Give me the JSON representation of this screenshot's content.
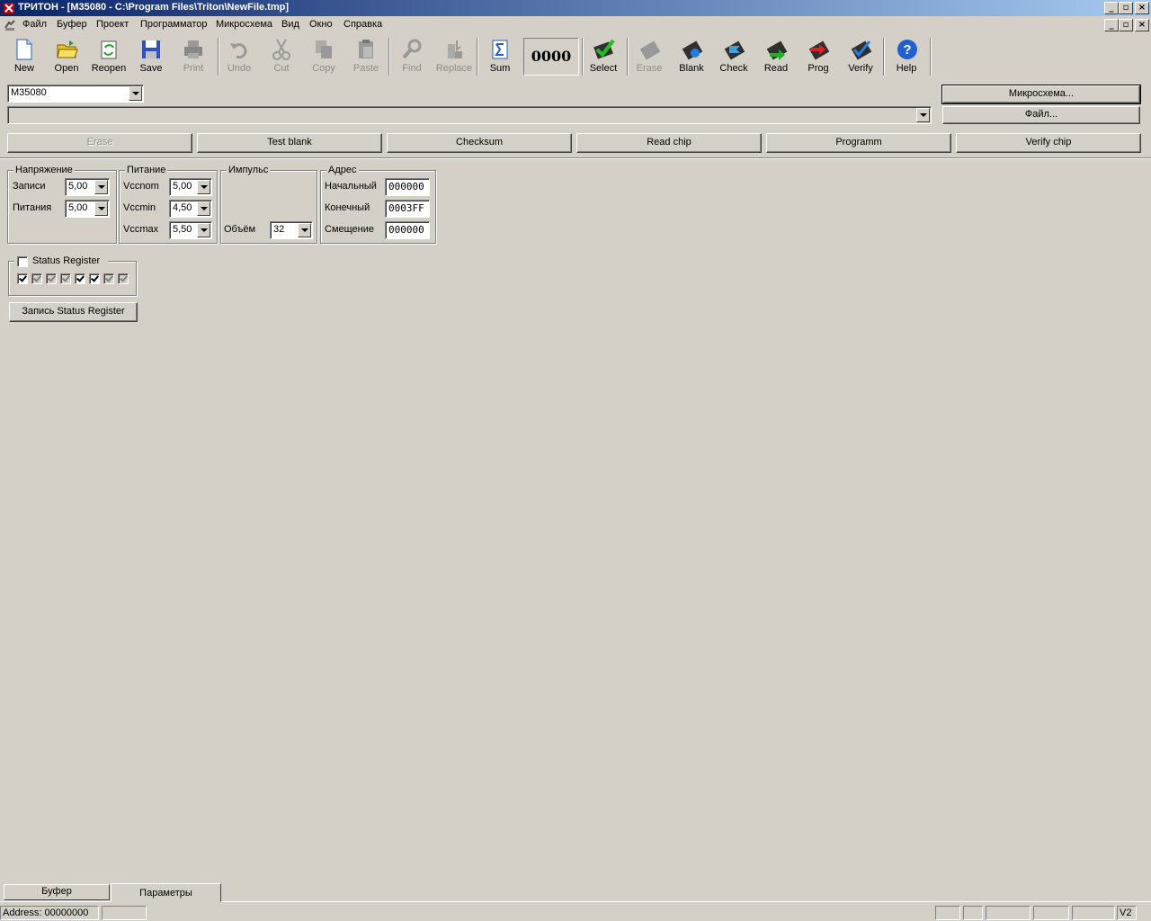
{
  "window": {
    "title": "ТРИТОН - [M35080 - C:\\Program Files\\Triton\\NewFile.tmp]",
    "caption_buttons": [
      "minimize",
      "restore",
      "close"
    ]
  },
  "menu": {
    "items": [
      "Файл",
      "Буфер",
      "Проект",
      "Программатор",
      "Микросхема",
      "Вид",
      "Окно",
      "Справка"
    ]
  },
  "toolbar": {
    "buttons": [
      {
        "label": "New",
        "icon": "new-file-icon",
        "enabled": true
      },
      {
        "label": "Open",
        "icon": "open-folder-icon",
        "enabled": true
      },
      {
        "label": "Reopen",
        "icon": "reopen-icon",
        "enabled": true
      },
      {
        "label": "Save",
        "icon": "save-icon",
        "enabled": true
      },
      {
        "label": "Print",
        "icon": "print-icon",
        "enabled": false
      },
      {
        "label": "Undo",
        "icon": "undo-icon",
        "enabled": false
      },
      {
        "label": "Cut",
        "icon": "cut-icon",
        "enabled": false
      },
      {
        "label": "Copy",
        "icon": "copy-icon",
        "enabled": false
      },
      {
        "label": "Paste",
        "icon": "paste-icon",
        "enabled": false
      },
      {
        "label": "Find",
        "icon": "find-icon",
        "enabled": false
      },
      {
        "label": "Replace",
        "icon": "replace-icon",
        "enabled": false
      },
      {
        "label": "Sum",
        "icon": "sum-icon",
        "enabled": true
      },
      {
        "label": "Select",
        "icon": "select-chip-icon",
        "enabled": true
      },
      {
        "label": "Erase",
        "icon": "erase-chip-icon",
        "enabled": false
      },
      {
        "label": "Blank",
        "icon": "blank-chip-icon",
        "enabled": true
      },
      {
        "label": "Check",
        "icon": "check-chip-icon",
        "enabled": true
      },
      {
        "label": "Read",
        "icon": "read-chip-icon",
        "enabled": true
      },
      {
        "label": "Prog",
        "icon": "prog-chip-icon",
        "enabled": true
      },
      {
        "label": "Verify",
        "icon": "verify-chip-icon",
        "enabled": true
      },
      {
        "label": "Help",
        "icon": "help-icon",
        "enabled": true
      }
    ],
    "counter": "0000"
  },
  "chip_select": {
    "value": "M35080"
  },
  "file_select": {
    "value": ""
  },
  "side_buttons": {
    "chip": "Микросхема...",
    "file": "Файл..."
  },
  "actions": [
    {
      "label": "Erase",
      "enabled": false
    },
    {
      "label": "Test  blank",
      "enabled": true
    },
    {
      "label": "Checksum",
      "enabled": true
    },
    {
      "label": "Read  chip",
      "enabled": true
    },
    {
      "label": "Programm",
      "enabled": true
    },
    {
      "label": "Verify  chip",
      "enabled": true
    }
  ],
  "voltage": {
    "caption": "Напряжение",
    "write_label": "Записи",
    "write_value": "5,00",
    "power_label": "Питания",
    "power_value": "5,00"
  },
  "supply": {
    "caption": "Питание",
    "vccnom_label": "Vccnom",
    "vccnom_value": "5,00",
    "vccmin_label": "Vccmin",
    "vccmin_value": "4,50",
    "vccmax_label": "Vccmax",
    "vccmax_value": "5,50"
  },
  "pulse": {
    "caption": "Импульс",
    "volume_label": "Объём",
    "volume_value": "32"
  },
  "address": {
    "caption": "Адрес",
    "start_label": "Начальный",
    "start_value": "000000",
    "end_label": "Конечный",
    "end_value": "0003FF",
    "offset_label": "Смещение",
    "offset_value": "000000"
  },
  "status_register": {
    "label": "Status Register",
    "enabled": false,
    "bits": [
      {
        "checked": true,
        "grey": false
      },
      {
        "checked": true,
        "grey": true
      },
      {
        "checked": true,
        "grey": true
      },
      {
        "checked": true,
        "grey": true
      },
      {
        "checked": true,
        "grey": false
      },
      {
        "checked": true,
        "grey": false
      },
      {
        "checked": true,
        "grey": true
      },
      {
        "checked": true,
        "grey": true
      }
    ],
    "write_button": "Запись Status Register"
  },
  "tabs": {
    "buffer": "Буфер",
    "params": "Параметры"
  },
  "statusbar": {
    "address": "Address: 00000000",
    "version": "V2"
  },
  "colors": {
    "face": "#d4d0c8",
    "title_start": "#0a246a",
    "title_end": "#a6caf0"
  }
}
